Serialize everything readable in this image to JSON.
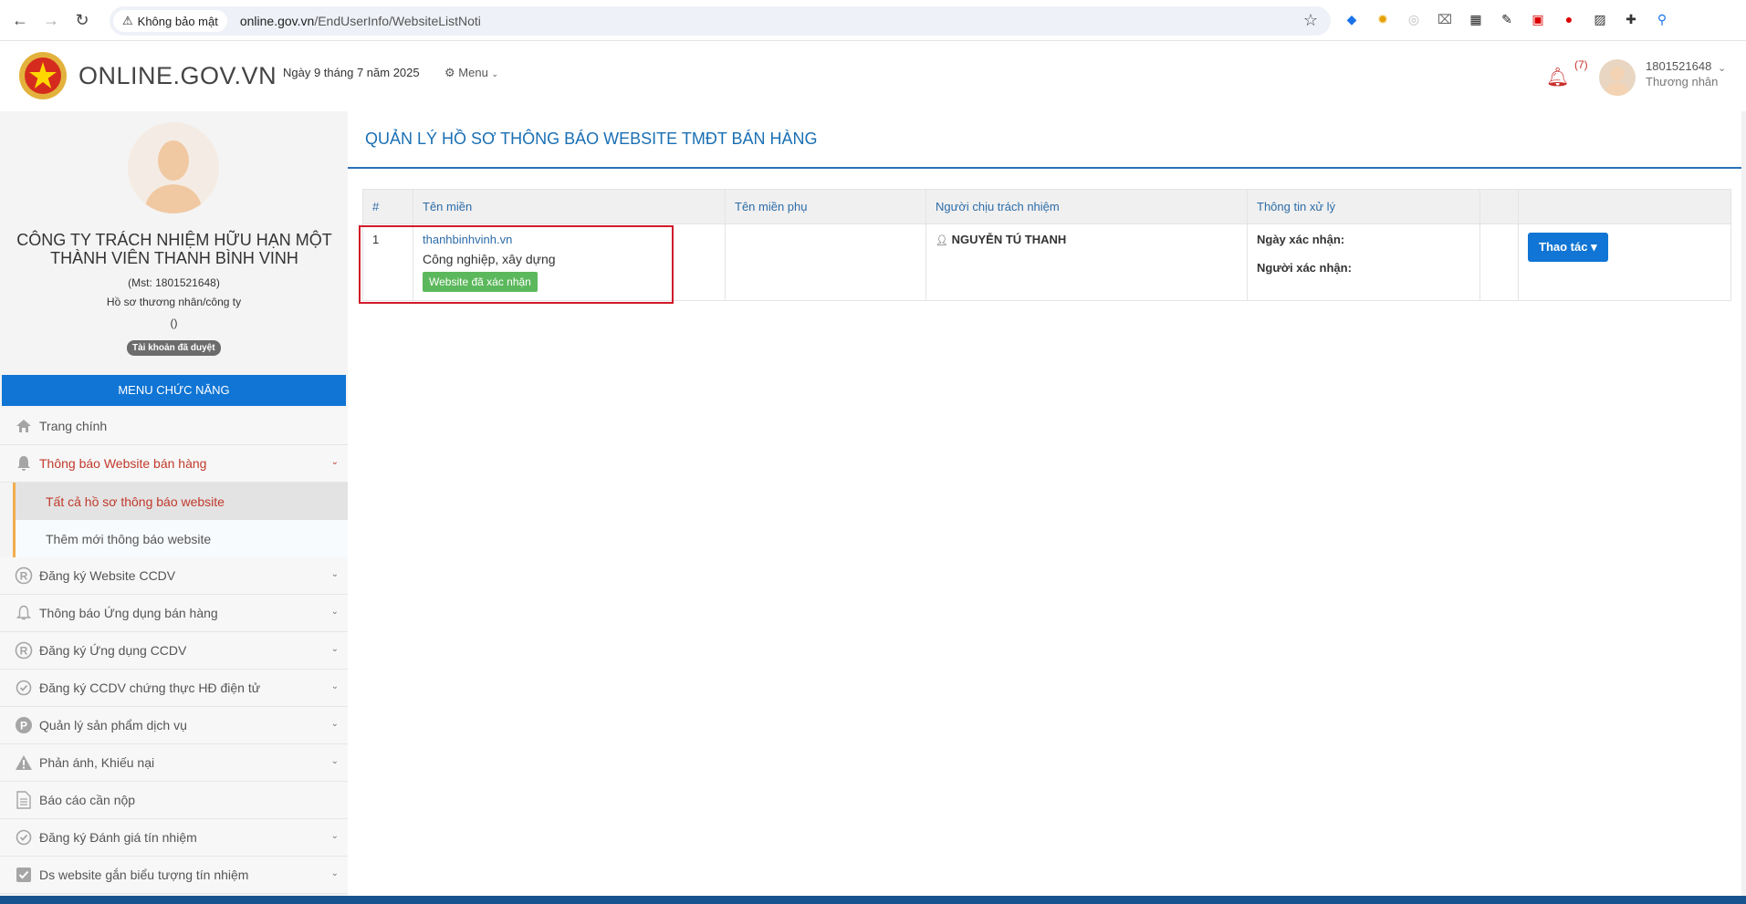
{
  "browser": {
    "security_label": "Không bảo mật",
    "url_host": "online.gov.vn",
    "url_path": "/EndUserInfo/WebsiteListNoti"
  },
  "header": {
    "brand": "ONLINE.GOV.VN",
    "date": "Ngày 9 tháng 7 năm 2025",
    "menu_label": "Menu",
    "notification_count": "(7)",
    "user_id": "1801521648",
    "user_role": "Thương nhân"
  },
  "profile": {
    "company": "CÔNG TY TRÁCH NHIỆM HỮU HẠN MỘT THÀNH VIÊN THANH BÌNH VINH",
    "mst": "(Mst: 1801521648)",
    "type": "Hồ sơ thương nhân/công ty",
    "parens": "()",
    "status": "Tài khoản đã duyệt"
  },
  "sidebar": {
    "menu_heading": "MENU CHỨC NĂNG",
    "items": [
      {
        "label": "Trang chính",
        "icon": "home-icon"
      },
      {
        "label": "Thông báo Website bán hàng",
        "icon": "bell-icon"
      },
      {
        "label": "Tất cả hồ sơ thông báo website"
      },
      {
        "label": "Thêm mới thông báo website"
      },
      {
        "label": "Đăng ký Website CCDV",
        "icon": "registered-icon"
      },
      {
        "label": "Thông báo Ứng dụng bán hàng",
        "icon": "bell-outline-icon"
      },
      {
        "label": "Đăng ký Ứng dụng CCDV",
        "icon": "registered-icon"
      },
      {
        "label": "Đăng ký CCDV chứng thực HĐ điện tử",
        "icon": "check-circle-icon"
      },
      {
        "label": "Quản lý sản phẩm dịch vụ",
        "icon": "p-circle-icon"
      },
      {
        "label": "Phản ánh, Khiếu nại",
        "icon": "warning-icon"
      },
      {
        "label": "Báo cáo cần nộp",
        "icon": "file-icon"
      },
      {
        "label": "Đăng ký Đánh giá tín nhiệm",
        "icon": "check-circle-icon"
      },
      {
        "label": "Ds website gắn biểu tượng tín nhiệm",
        "icon": "check-square-icon"
      }
    ]
  },
  "main": {
    "title": "QUẢN LÝ HỒ SƠ THÔNG BÁO WEBSITE TMĐT BÁN HÀNG",
    "columns": [
      "#",
      "Tên miền",
      "Tên miền phụ",
      "Người chịu trách nhiệm",
      "Thông tin xử lý"
    ],
    "rows": [
      {
        "index": "1",
        "domain": "thanhbinhvinh.vn",
        "industry": "Công nghiệp, xây dựng",
        "status": "Website đã xác nhận",
        "subdomain": "",
        "responsible": "NGUYỄN TÚ THANH",
        "confirm_date_label": "Ngày xác nhận:",
        "confirmer_label": "Người xác nhận:",
        "action_label": "Thao tác"
      }
    ]
  },
  "colors": {
    "accent": "#1075d4",
    "title": "#1a6fb3",
    "active": "#c0392b",
    "success": "#5cb85c",
    "highlight": "#d11a2a"
  }
}
